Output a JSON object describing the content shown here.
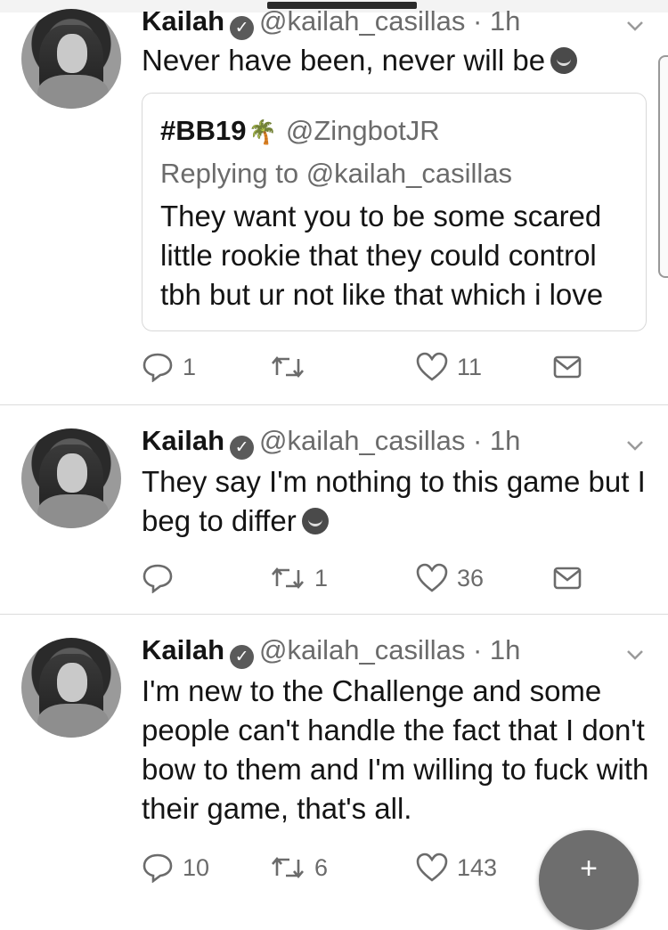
{
  "tweets": [
    {
      "name": "Kailah",
      "handle": "@kailah_casillas · 1h",
      "text": "Never have been, never will be",
      "quote": {
        "name": "#BB19",
        "handle": "@ZingbotJR",
        "replying": "Replying to @kailah_casillas",
        "text": "They want you to be some scared little rookie that they could control tbh but ur not like that which i love"
      },
      "reply_count": "1",
      "retweet_count": "",
      "like_count": "11"
    },
    {
      "name": "Kailah",
      "handle": "@kailah_casillas · 1h",
      "text": "They say I'm nothing to this game but I beg to differ",
      "reply_count": "",
      "retweet_count": "1",
      "like_count": "36"
    },
    {
      "name": "Kailah",
      "handle": "@kailah_casillas · 1h",
      "text": "I'm new to the Challenge and some people can't handle the fact that I don't bow to them and I'm willing to fuck with their game, that's all.",
      "reply_count": "10",
      "retweet_count": "6",
      "like_count": "143"
    }
  ],
  "fab": {
    "label": "+"
  },
  "icons": {
    "reply": "reply-icon",
    "retweet": "retweet-icon",
    "like": "heart-icon",
    "dm": "envelope-icon",
    "verified": "verified-badge-icon",
    "chevron": "chevron-down-icon",
    "compose": "compose-feather-icon"
  }
}
